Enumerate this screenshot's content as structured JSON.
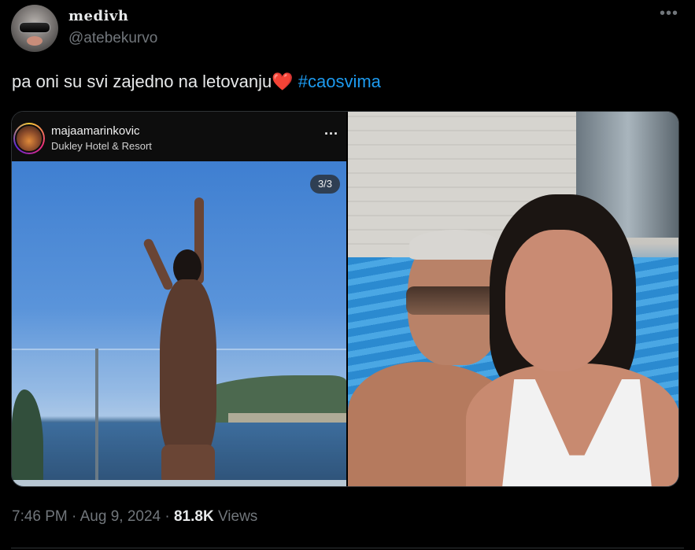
{
  "author": {
    "display_name": "medivh",
    "handle": "@atebekurvo"
  },
  "more_icon": "more-horizontal-icon",
  "tweet": {
    "text": "pa oni su svi zajedno na letovanju",
    "emoji": "❤️",
    "hashtag": "#caosvima"
  },
  "instagram": {
    "username": "majaamarinkovic",
    "location": "Dukley Hotel & Resort",
    "counter": "3/3",
    "more_icon": "more-horizontal-icon"
  },
  "meta": {
    "time": "7:46 PM",
    "separator1": "·",
    "date": "Aug 9, 2024",
    "separator2": "·",
    "views_count": "81.8K",
    "views_label": "Views"
  },
  "colors": {
    "background": "#000000",
    "text": "#e7e9ea",
    "muted": "#71767b",
    "hashtag": "#1d9bf0",
    "heart": "#e0245e"
  }
}
